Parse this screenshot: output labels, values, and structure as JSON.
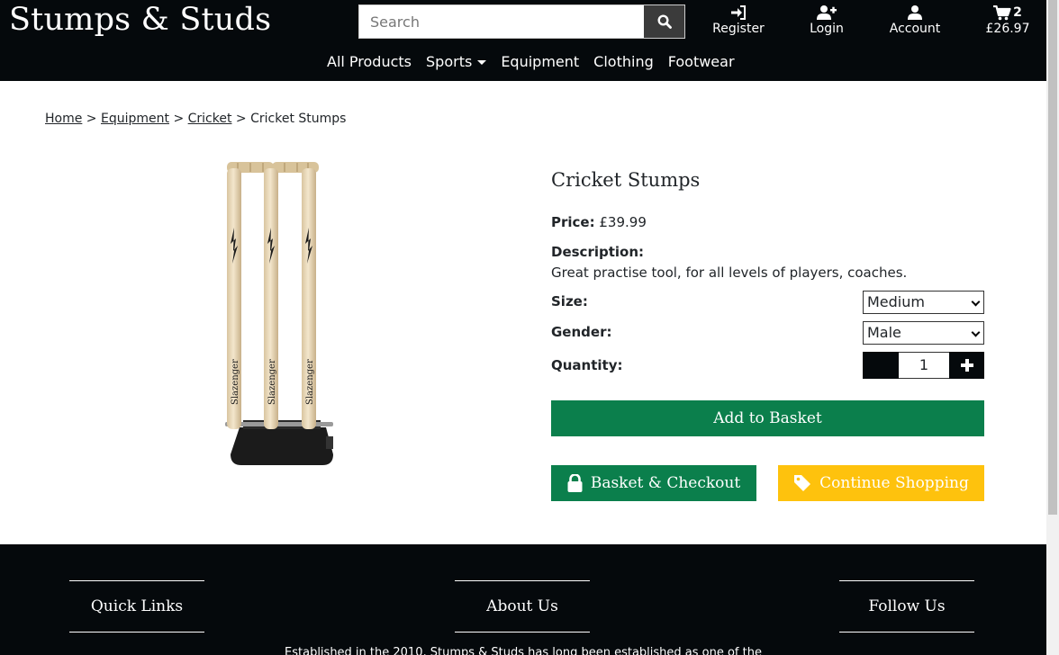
{
  "header": {
    "brand": "Stumps & Studs",
    "search_placeholder": "Search",
    "register_label": "Register",
    "login_label": "Login",
    "account_label": "Account",
    "basket_count": "2",
    "basket_total": "£26.97"
  },
  "nav": {
    "items": [
      "All Products",
      "Sports",
      "Equipment",
      "Clothing",
      "Footwear"
    ]
  },
  "breadcrumb": {
    "home": "Home",
    "equipment": "Equipment",
    "cricket": "Cricket",
    "current": "Cricket Stumps",
    "sep": ">"
  },
  "product": {
    "title": "Cricket Stumps",
    "price_label": "Price:",
    "price_value": "£39.99",
    "description_label": "Description:",
    "description": "Great practise tool, for all levels of players, coaches.",
    "size_label": "Size:",
    "size_value": "Medium",
    "gender_label": "Gender:",
    "gender_value": "Male",
    "quantity_label": "Quantity:",
    "quantity_value": "1",
    "image_brand_text": "Slazenger"
  },
  "actions": {
    "add_to_basket": "Add to Basket",
    "checkout": "Basket & Checkout",
    "continue": "Continue Shopping"
  },
  "footer": {
    "quick_links": "Quick Links",
    "about_us": "About Us",
    "follow_us": "Follow Us",
    "about_text": "Established in the 2010, Stumps & Studs has long been established as one of the"
  },
  "colors": {
    "header_bg": "#05090c",
    "primary_green": "#0b7f4c",
    "accent_yellow": "#fec20d"
  },
  "icons": {
    "search": "search-icon",
    "register": "sign-in-icon",
    "login": "user-plus-icon",
    "account": "user-icon",
    "basket": "shopping-cart-icon",
    "checkout": "lock-icon",
    "continue": "tag-icon"
  }
}
